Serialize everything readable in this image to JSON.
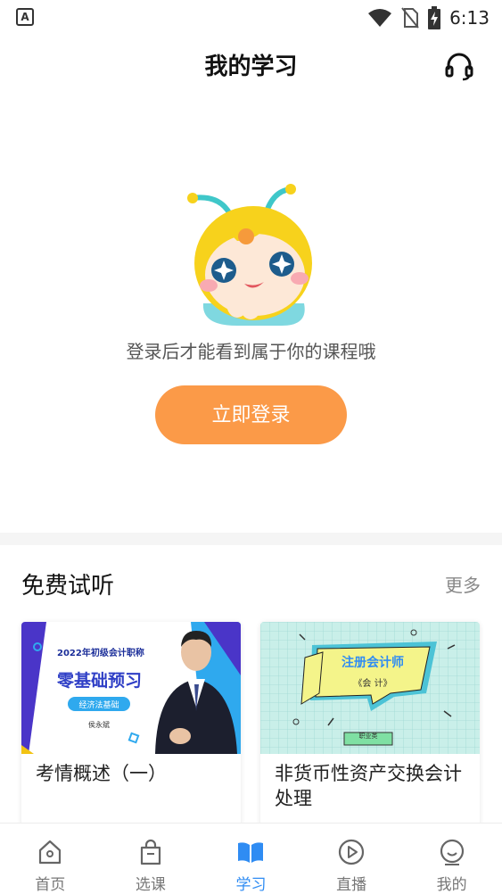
{
  "status_bar": {
    "left_icon": "A",
    "time": "6:13",
    "icons": [
      "wifi-icon",
      "no-sim-icon",
      "battery-charging-icon"
    ]
  },
  "header": {
    "title": "我的学习",
    "right_icon": "headset-icon"
  },
  "empty_state": {
    "message": "登录后才能看到属于你的课程哦",
    "login_button": "立即登录",
    "mascot": "bee-mascot-illustration"
  },
  "free_trial": {
    "title": "免费试听",
    "more": "更多",
    "cards": [
      {
        "title": "考情概述（一）",
        "thumb": {
          "year_line": "2022年初级会计职称",
          "headline": "零基础预习",
          "subject": "经济法基础",
          "teacher": "侯永斌"
        }
      },
      {
        "title": "非货币性资产交换会计处理",
        "thumb": {
          "headline": "注册会计师",
          "subject": "《会 计》",
          "tag": "职业类"
        }
      }
    ]
  },
  "bottom_nav": {
    "items": [
      {
        "label": "首页",
        "icon": "home-icon",
        "active": false
      },
      {
        "label": "选课",
        "icon": "shopping-bag-icon",
        "active": false
      },
      {
        "label": "学习",
        "icon": "open-book-icon",
        "active": true
      },
      {
        "label": "直播",
        "icon": "play-circle-icon",
        "active": false
      },
      {
        "label": "我的",
        "icon": "profile-face-icon",
        "active": false
      }
    ]
  },
  "colors": {
    "accent": "#fb9a48",
    "active_nav": "#2f8cf3",
    "text_primary": "#111111",
    "text_secondary": "#555555"
  }
}
